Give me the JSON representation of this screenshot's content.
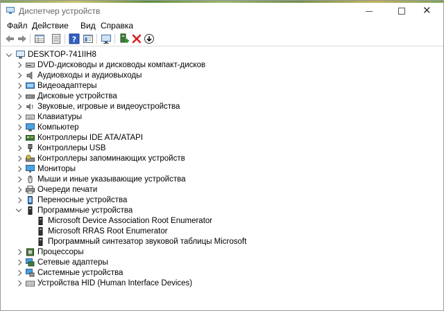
{
  "window": {
    "title": "Диспетчер устройств",
    "controls": [
      "minimize",
      "maximize",
      "close"
    ]
  },
  "menu": [
    "Файл",
    "Действие",
    "Вид",
    "Справка"
  ],
  "toolbar": {
    "icons": [
      "back-icon",
      "forward-icon",
      "properties-grid-icon",
      "list-view-icon",
      "help-icon",
      "properties-icon",
      "monitor-scan-icon",
      "add-driver-icon",
      "delete-icon",
      "download-icon"
    ]
  },
  "tree": {
    "root": "DESKTOP-741IIH8",
    "categories": [
      {
        "label": "DVD-дисководы и дисководы компакт-дисков",
        "icon": "dvd-drive-icon"
      },
      {
        "label": "Аудиовходы и аудиовыходы",
        "icon": "speaker-icon"
      },
      {
        "label": "Видеоадаптеры",
        "icon": "display-adapter-icon"
      },
      {
        "label": "Дисковые устройства",
        "icon": "disk-drive-icon"
      },
      {
        "label": "Звуковые, игровые и видеоустройства",
        "icon": "sound-device-icon"
      },
      {
        "label": "Клавиатуры",
        "icon": "keyboard-icon"
      },
      {
        "label": "Компьютер",
        "icon": "computer-icon"
      },
      {
        "label": "Контроллеры IDE ATA/ATAPI",
        "icon": "ide-controller-icon"
      },
      {
        "label": "Контроллеры USB",
        "icon": "usb-icon"
      },
      {
        "label": "Контроллеры запоминающих устройств",
        "icon": "storage-controller-icon"
      },
      {
        "label": "Мониторы",
        "icon": "monitor-icon"
      },
      {
        "label": "Мыши и иные указывающие устройства",
        "icon": "mouse-icon"
      },
      {
        "label": "Очереди печати",
        "icon": "printer-icon"
      },
      {
        "label": "Переносные устройства",
        "icon": "portable-device-icon"
      },
      {
        "label": "Программные устройства",
        "icon": "software-device-icon",
        "expanded": true
      },
      {
        "label": "Процессоры",
        "icon": "processor-icon"
      },
      {
        "label": "Сетевые адаптеры",
        "icon": "network-adapter-icon"
      },
      {
        "label": "Системные устройства",
        "icon": "system-device-icon"
      },
      {
        "label": "Устройства HID (Human Interface Devices)",
        "icon": "hid-icon"
      }
    ],
    "software_children": [
      "Microsoft Device Association Root Enumerator",
      "Microsoft RRAS Root Enumerator",
      "Программный синтезатор звуковой таблицы Microsoft"
    ]
  }
}
